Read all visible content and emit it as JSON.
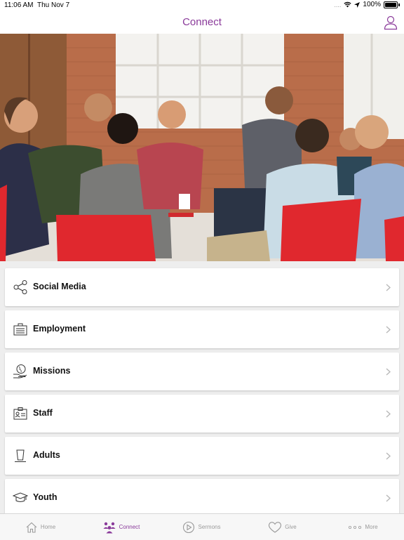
{
  "status": {
    "time": "11:06 AM",
    "date": "Thu Nov 7",
    "signal": "....",
    "battery": "100%"
  },
  "nav": {
    "title": "Connect",
    "profile_icon": "person-icon"
  },
  "hero": {
    "description_icon": "group-photo"
  },
  "menu": [
    {
      "label": "Social Media",
      "icon": "share-icon"
    },
    {
      "label": "Employment",
      "icon": "briefcase-icon"
    },
    {
      "label": "Missions",
      "icon": "globe-hand-icon"
    },
    {
      "label": "Staff",
      "icon": "id-card-icon"
    },
    {
      "label": "Adults",
      "icon": "coffee-cup-icon"
    },
    {
      "label": "Youth",
      "icon": "graduation-cap-icon"
    }
  ],
  "tabs": [
    {
      "label": "Home",
      "icon": "home-icon"
    },
    {
      "label": "Connect",
      "icon": "people-icon",
      "active": true
    },
    {
      "label": "Sermons",
      "icon": "play-icon"
    },
    {
      "label": "Give",
      "icon": "heart-icon"
    },
    {
      "label": "More",
      "icon": "dots-icon"
    }
  ],
  "colors": {
    "accent": "#8a3a9a",
    "inactive": "#9a9a9a",
    "background": "#eeeeee",
    "chairs": "#e0282e"
  }
}
